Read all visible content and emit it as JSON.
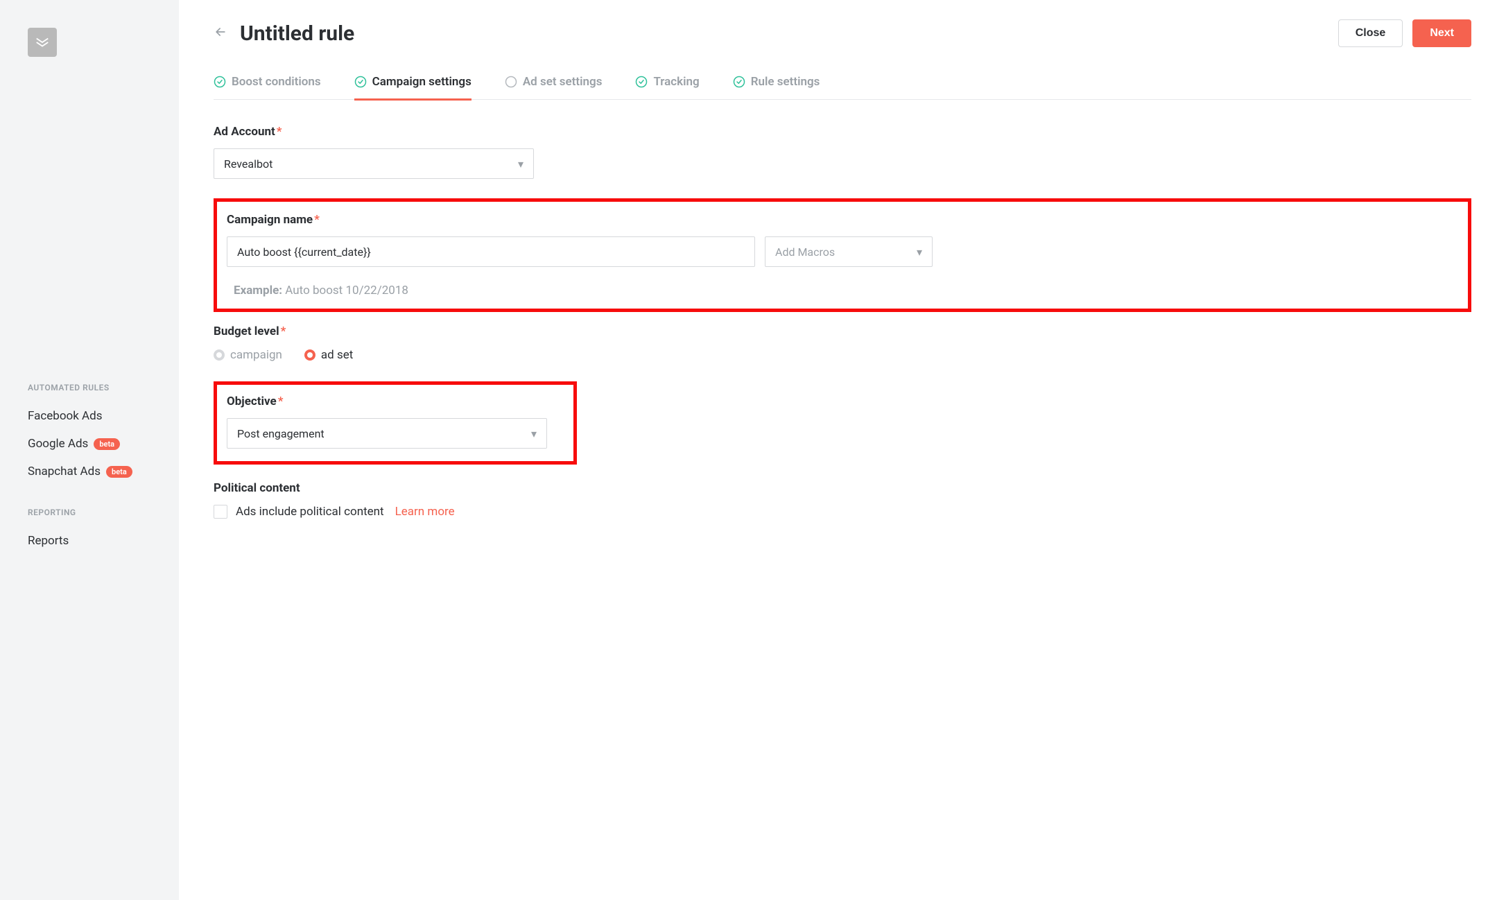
{
  "sidebar": {
    "section1_label": "AUTOMATED RULES",
    "items1": [
      "Facebook Ads",
      "Google Ads",
      "Snapchat Ads"
    ],
    "badges": [
      "",
      "beta",
      "beta"
    ],
    "section2_label": "REPORTING",
    "items2": [
      "Reports"
    ]
  },
  "header": {
    "title": "Untitled rule",
    "close": "Close",
    "next": "Next"
  },
  "tabs": [
    {
      "label": "Boost conditions",
      "status": "check"
    },
    {
      "label": "Campaign settings",
      "status": "check",
      "active": true
    },
    {
      "label": "Ad set settings",
      "status": "empty"
    },
    {
      "label": "Tracking",
      "status": "check"
    },
    {
      "label": "Rule settings",
      "status": "check"
    }
  ],
  "ad_account": {
    "label": "Ad Account",
    "value": "Revealbot"
  },
  "campaign_name": {
    "label": "Campaign name",
    "value": "Auto boost {{current_date}}",
    "macros_placeholder": "Add Macros",
    "example_label": "Example:",
    "example_value": "Auto boost 10/22/2018"
  },
  "budget_level": {
    "label": "Budget level",
    "options": [
      "campaign",
      "ad set"
    ],
    "selected": "ad set"
  },
  "objective": {
    "label": "Objective",
    "value": "Post engagement"
  },
  "political": {
    "label": "Political content",
    "text": "Ads include political content",
    "learn_more": "Learn more"
  }
}
